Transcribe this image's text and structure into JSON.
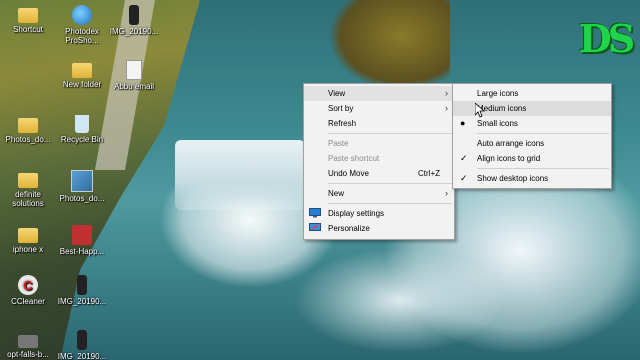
{
  "desktop": {
    "logo_text": "DS",
    "icons": [
      {
        "label": "Shortcut",
        "icon": "folder-icon"
      },
      {
        "label": "Photodex ProSho...",
        "icon": "globe-icon"
      },
      {
        "label": "IMG_20190...",
        "icon": "phone-icon"
      },
      {
        "label": "New folder",
        "icon": "folder-icon"
      },
      {
        "label": "Abbu email",
        "icon": "document-icon"
      },
      {
        "label": "Photos_do...",
        "icon": "folder-icon"
      },
      {
        "label": "Recycle Bin",
        "icon": "recycle-bin-icon"
      },
      {
        "label": "definite solutions",
        "icon": "folder-icon"
      },
      {
        "label": "Photos_do...",
        "icon": "image-icon"
      },
      {
        "label": "iphone x",
        "icon": "folder-icon"
      },
      {
        "label": "Best-Happ...",
        "icon": "image-icon"
      },
      {
        "label": "CCleaner",
        "icon": "ccleaner-icon"
      },
      {
        "label": "IMG_20190...",
        "icon": "phone-icon"
      },
      {
        "label": "opt-falls-b...",
        "icon": "laptop-icon"
      },
      {
        "label": "IMG_20190...",
        "icon": "phone-icon"
      }
    ]
  },
  "context_menu": {
    "items": {
      "view": "View",
      "sort_by": "Sort by",
      "refresh": "Refresh",
      "paste": "Paste",
      "paste_shortcut": "Paste shortcut",
      "undo_move": "Undo Move",
      "undo_shortcut": "Ctrl+Z",
      "new": "New",
      "display_settings": "Display settings",
      "personalize": "Personalize"
    }
  },
  "view_submenu": {
    "large_icons": "Large icons",
    "medium_icons": "Medium icons",
    "small_icons": "Small icons",
    "auto_arrange": "Auto arrange icons",
    "align_to_grid": "Align icons to grid",
    "show_desktop_icons": "Show desktop icons",
    "selected_size": "Small icons",
    "checked": [
      "Align icons to grid",
      "Show desktop icons"
    ]
  },
  "colors": {
    "menu_bg": "#f2f2f2",
    "menu_highlight": "#dcdcdc",
    "logo_green": "#1ed44a"
  }
}
